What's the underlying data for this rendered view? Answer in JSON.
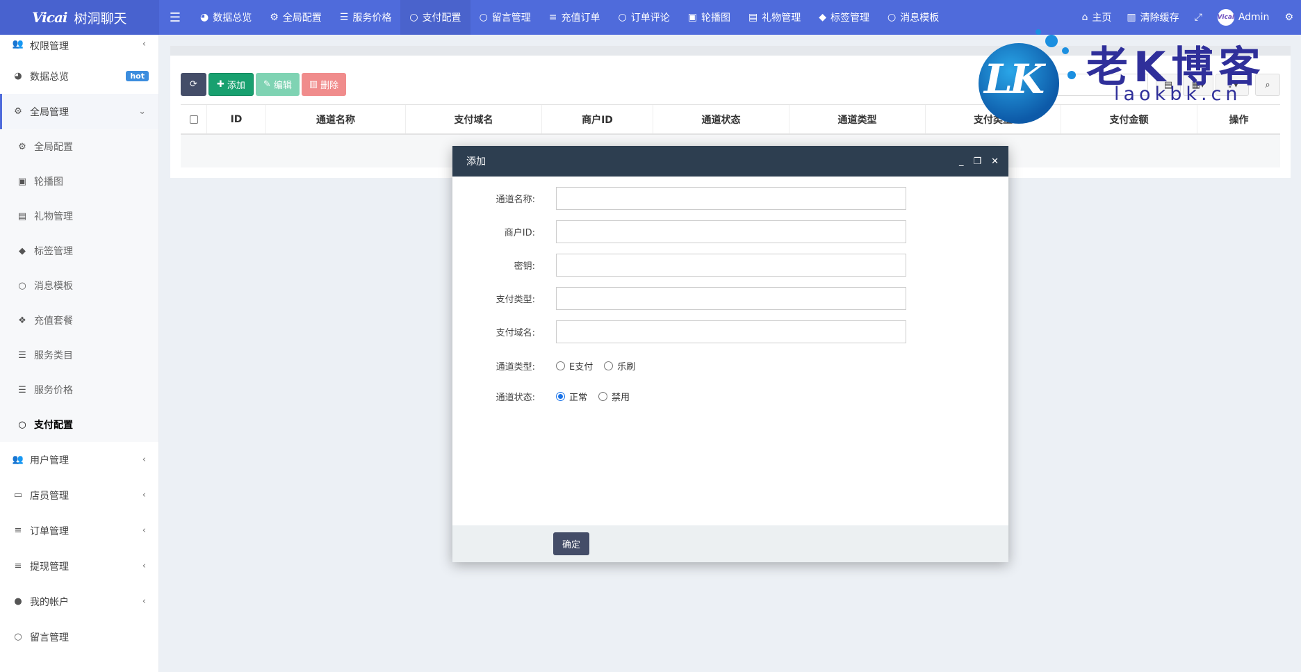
{
  "brand": {
    "logo_text": "Vicai",
    "name": "树洞聊天"
  },
  "topnav": {
    "items": [
      {
        "label": "数据总览",
        "icon": "dashboard-icon"
      },
      {
        "label": "全局配置",
        "icon": "cogs-icon"
      },
      {
        "label": "服务价格",
        "icon": "list-icon"
      },
      {
        "label": "支付配置",
        "icon": "circle-icon"
      },
      {
        "label": "留言管理",
        "icon": "circle-icon"
      },
      {
        "label": "充值订单",
        "icon": "database-icon"
      },
      {
        "label": "订单评论",
        "icon": "circle-icon"
      },
      {
        "label": "轮播图",
        "icon": "image-icon"
      },
      {
        "label": "礼物管理",
        "icon": "gift-icon"
      },
      {
        "label": "标签管理",
        "icon": "tags-icon"
      },
      {
        "label": "消息模板",
        "icon": "circle-icon"
      }
    ],
    "home": "主页",
    "clear_cache": "清除缓存",
    "user": "Admin",
    "avatar_text": "Vicai"
  },
  "sidebar": {
    "top_item": "权限管理",
    "dashboard": "数据总览",
    "dashboard_badge": "hot",
    "global_group": "全局管理",
    "sub_items": [
      "全局配置",
      "轮播图",
      "礼物管理",
      "标签管理",
      "消息模板",
      "充值套餐",
      "服务类目",
      "服务价格",
      "支付配置"
    ],
    "groups": [
      "用户管理",
      "店员管理",
      "订单管理",
      "提现管理",
      "我的帐户"
    ],
    "bottom_item": "留言管理"
  },
  "toolbar": {
    "add": "添加",
    "edit": "编辑",
    "delete": "删除"
  },
  "table": {
    "columns": [
      "ID",
      "通道名称",
      "支付域名",
      "商户ID",
      "通道状态",
      "通道类型",
      "支付类型",
      "支付金额",
      "操作"
    ]
  },
  "watermark": {
    "logo": "LK",
    "title": "老K博客",
    "url": "laokbk.cn"
  },
  "modal": {
    "title": "添加",
    "fields": {
      "channel_name": "通道名称:",
      "merchant_id": "商户ID:",
      "secret": "密钥:",
      "pay_type": "支付类型:",
      "pay_domain": "支付域名:"
    },
    "channel_type": {
      "label": "通道类型:",
      "options": [
        "E支付",
        "乐刷"
      ]
    },
    "channel_status": {
      "label": "通道状态:",
      "options": [
        "正常",
        "禁用"
      ]
    },
    "ok": "确定"
  }
}
